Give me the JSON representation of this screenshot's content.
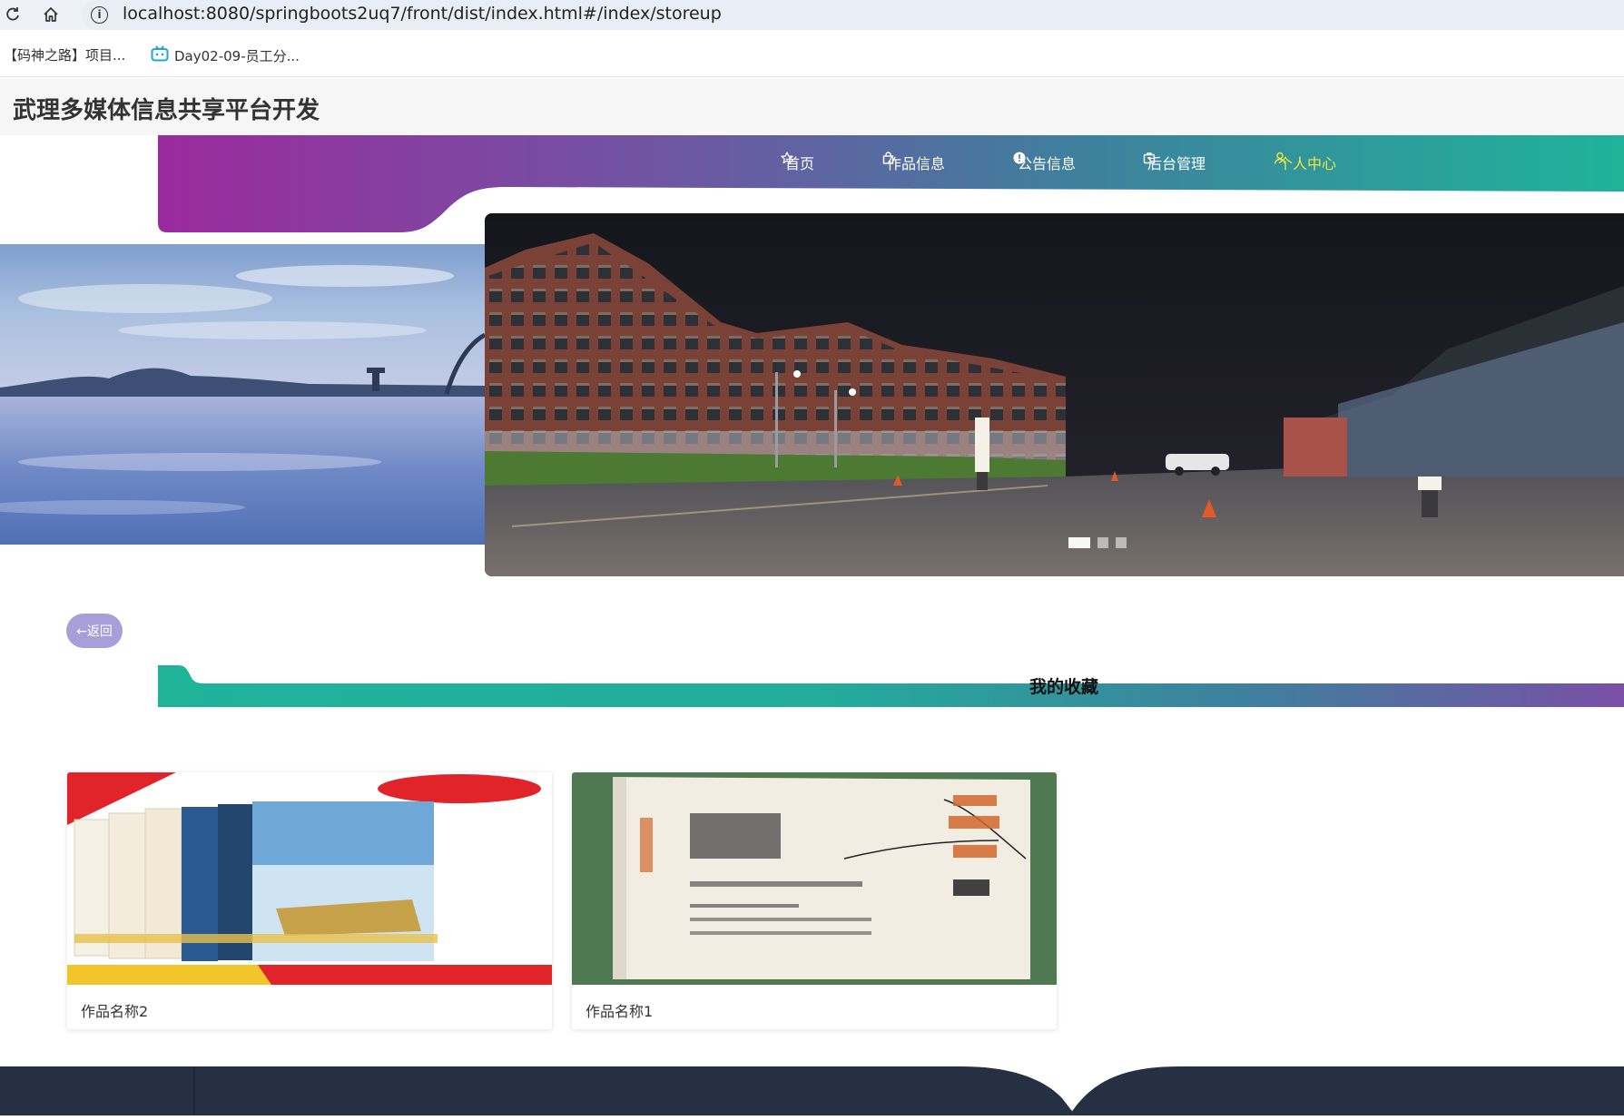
{
  "browser": {
    "url": "localhost:8080/springboots2uq7/front/dist/index.html#/index/storeup",
    "bookmarks": [
      {
        "label": "【码神之路】项目..."
      },
      {
        "label": "Day02-09-员工分..."
      }
    ]
  },
  "site": {
    "title": "武理多媒体信息共享平台开发"
  },
  "nav": {
    "items": [
      {
        "label": "首页",
        "icon": "star-icon"
      },
      {
        "label": "作品信息",
        "icon": "bag-icon"
      },
      {
        "label": "公告信息",
        "icon": "info-icon"
      },
      {
        "label": "后台管理",
        "icon": "briefcase-icon"
      },
      {
        "label": "个人中心",
        "icon": "user-icon",
        "active": true
      }
    ]
  },
  "carousel": {
    "active_index": 0,
    "slides": 3
  },
  "back_button": {
    "label": "←返回"
  },
  "section": {
    "title": "我的收藏"
  },
  "favorites": [
    {
      "name": "作品名称2"
    },
    {
      "name": "作品名称1"
    }
  ],
  "colors": {
    "purple": "#9b2a9e",
    "teal": "#22b09b",
    "active_nav": "#f1ea3d",
    "footer": "#253142",
    "back_button": "#a89fd9"
  }
}
